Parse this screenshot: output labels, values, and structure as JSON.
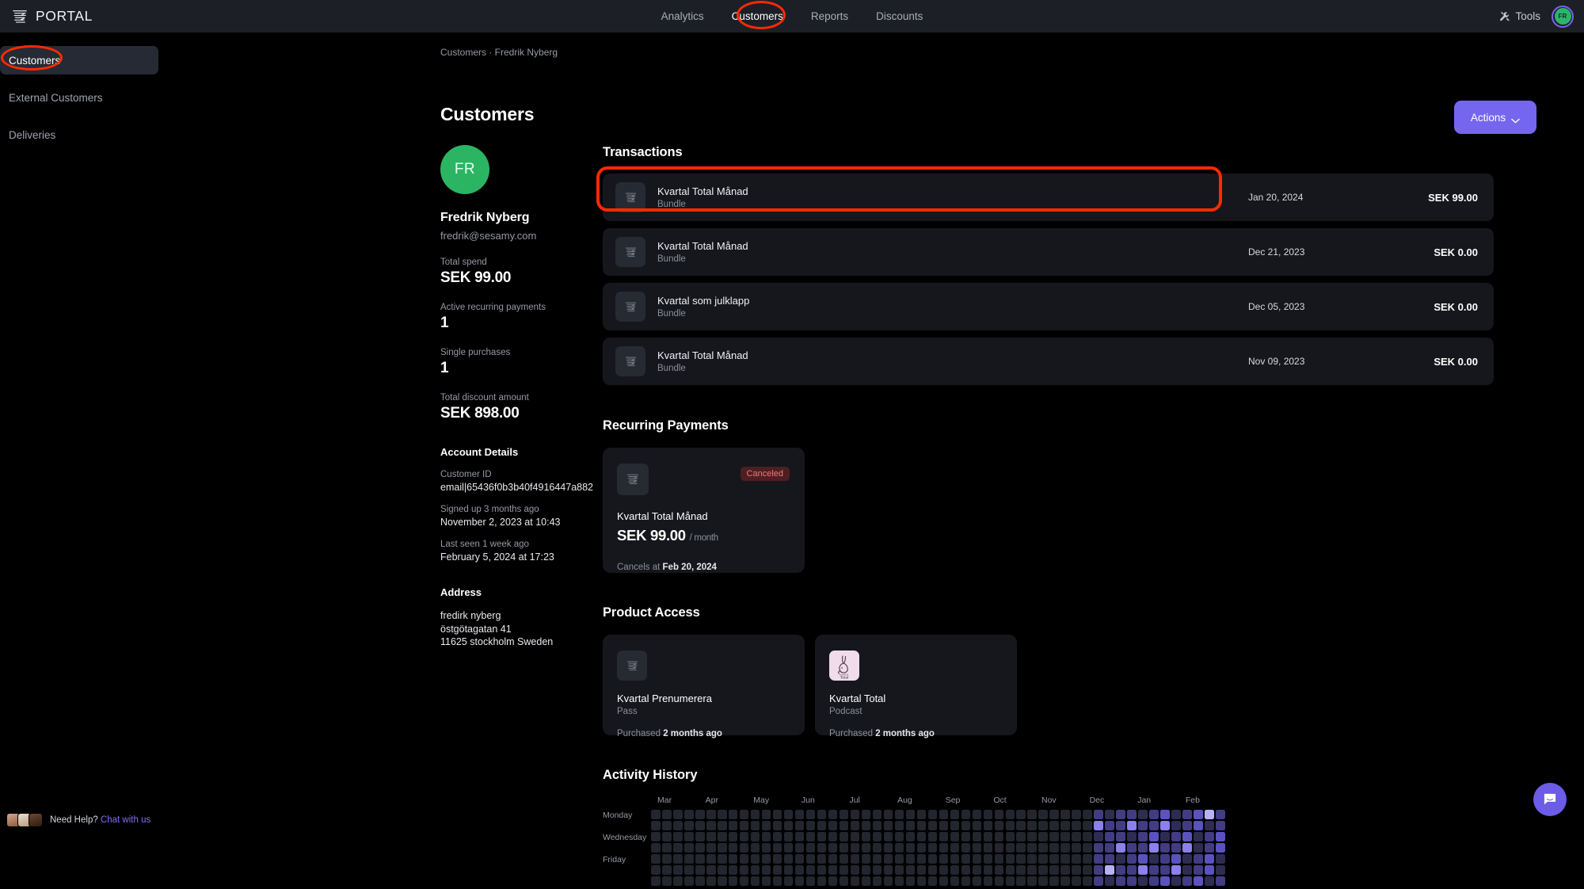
{
  "header": {
    "brand": "PORTAL",
    "brand_logo_icon": "wave-lines-logo",
    "nav": [
      {
        "label": "Analytics",
        "active": false
      },
      {
        "label": "Customers",
        "active": true
      },
      {
        "label": "Reports",
        "active": false
      },
      {
        "label": "Discounts",
        "active": false
      }
    ],
    "tools_label": "Tools",
    "tools_icon": "tools-icon",
    "avatar_initials": "FR"
  },
  "sidebar": {
    "items": [
      {
        "label": "Customers",
        "active": true
      },
      {
        "label": "External Customers",
        "active": false
      },
      {
        "label": "Deliveries",
        "active": false
      }
    ]
  },
  "main": {
    "breadcrumb": "Customers · Fredrik Nyberg",
    "page_title": "Customers",
    "actions_label": "Actions"
  },
  "profile": {
    "avatar_initials": "FR",
    "name": "Fredrik Nyberg",
    "email": "fredrik@sesamy.com",
    "stats": [
      {
        "label": "Total spend",
        "value": "SEK 99.00"
      },
      {
        "label": "Active recurring payments",
        "value": "1"
      },
      {
        "label": "Single purchases",
        "value": "1"
      },
      {
        "label": "Total discount amount",
        "value": "SEK 898.00"
      }
    ],
    "account_details_title": "Account Details",
    "fields": [
      {
        "label": "Customer ID",
        "value": "email|65436f0b3b40f4916447a882"
      },
      {
        "label": "Signed up 3 months ago",
        "value": "November 2, 2023 at 10:43"
      },
      {
        "label": "Last seen 1 week ago",
        "value": "February 5, 2024 at 17:23"
      }
    ],
    "address_title": "Address",
    "address_lines": [
      "fredirk nyberg",
      "östgötagatan 41",
      "11625 stockholm Sweden"
    ]
  },
  "transactions": {
    "title": "Transactions",
    "rows": [
      {
        "name": "Kvartal Total Månad",
        "type": "Bundle",
        "date": "Jan 20, 2024",
        "amount": "SEK 99.00",
        "highlighted": true
      },
      {
        "name": "Kvartal Total Månad",
        "type": "Bundle",
        "date": "Dec 21, 2023",
        "amount": "SEK 0.00",
        "highlighted": false
      },
      {
        "name": "Kvartal som julklapp",
        "type": "Bundle",
        "date": "Dec 05, 2023",
        "amount": "SEK 0.00",
        "highlighted": false
      },
      {
        "name": "Kvartal Total Månad",
        "type": "Bundle",
        "date": "Nov 09, 2023",
        "amount": "SEK 0.00",
        "highlighted": false
      }
    ]
  },
  "recurring_payments": {
    "title": "Recurring Payments",
    "card": {
      "badge": "Canceled",
      "name": "Kvartal Total Månad",
      "price": "SEK 99.00",
      "period": "/ month",
      "cancel_prefix": "Cancels at ",
      "cancel_date": "Feb 20, 2024"
    }
  },
  "product_access": {
    "title": "Product Access",
    "cards": [
      {
        "name": "Kvartal Prenumerera",
        "type": "Pass",
        "purchased_prefix": "Purchased ",
        "purchased": "2 months ago",
        "icon": "wave-lines-logo",
        "pink": false
      },
      {
        "name": "Kvartal Total",
        "type": "Podcast",
        "purchased_prefix": "Purchased ",
        "purchased": "2 months ago",
        "icon": "rabbit-total-logo",
        "pink": true
      }
    ]
  },
  "activity_history": {
    "title": "Activity History",
    "months": [
      "Mar",
      "Apr",
      "May",
      "Jun",
      "Jul",
      "Aug",
      "Sep",
      "Oct",
      "Nov",
      "Dec",
      "Jan",
      "Feb"
    ],
    "day_labels": [
      "Monday",
      "",
      "Wednesday",
      "",
      "Friday",
      "",
      ""
    ],
    "weeks": 52,
    "rows": 7,
    "colors": {
      "empty": "#23262e",
      "l1": "#2f2c52",
      "l2": "#423c84",
      "l3": "#5b52c2",
      "l4": "#8b80ee",
      "l5": "#b9b1f7"
    }
  },
  "footer": {
    "need_help_text": "Need Help? ",
    "chat_link": "Chat with us",
    "chat_fab_icon": "chat-bubble-icon"
  },
  "colors": {
    "accent": "#7566ef",
    "annotation": "#ff2a00",
    "avatar_green": "#2bb563",
    "background": "#000000",
    "panel": "#15171c",
    "topbar": "#1c1f26"
  }
}
